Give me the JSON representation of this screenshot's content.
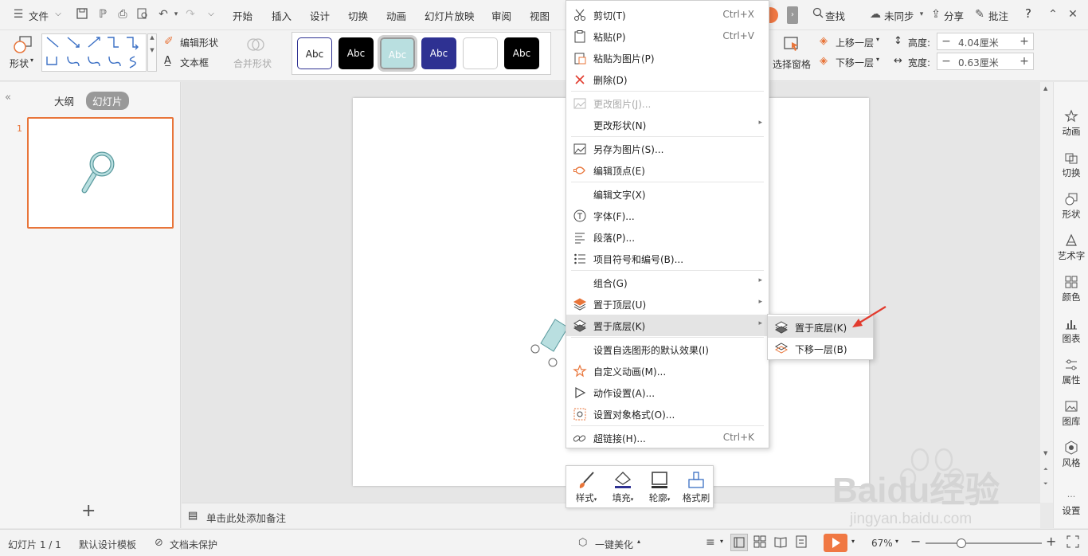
{
  "menubar": {
    "file": "文件",
    "tabs": [
      "开始",
      "插入",
      "设计",
      "切换",
      "动画",
      "幻灯片放映",
      "审阅",
      "视图"
    ],
    "search": "查找",
    "sync": "未同步",
    "share": "分享",
    "comment": "批注",
    "help": "?"
  },
  "ribbon": {
    "shape": "形状",
    "edit_shape": "编辑形状",
    "textbox": "文本框",
    "merge_shape": "合并形状",
    "style_boxes": [
      "Abc",
      "Abc",
      "Abc",
      "Abc",
      "",
      "Abc"
    ],
    "select_pane": "选择窗格",
    "bring_forward": "上移一层",
    "send_backward": "下移一层",
    "height_label": "高度:",
    "height_value": "4.04厘米",
    "width_label": "宽度:",
    "width_value": "0.63厘米",
    "minus": "−",
    "plus": "+"
  },
  "left_panel": {
    "tab_outline": "大纲",
    "tab_slides": "幻灯片",
    "slide_number": "1",
    "collapse": "«",
    "add": "+"
  },
  "notes": {
    "placeholder": "单击此处添加备注"
  },
  "right_sidebar": {
    "items": [
      "动画",
      "切换",
      "形状",
      "艺术字",
      "颜色",
      "图表",
      "属性",
      "图库",
      "风格",
      "设置"
    ],
    "more": "···"
  },
  "status": {
    "slide_info": "幻灯片 1 / 1",
    "template": "默认设计模板",
    "protect": "文档未保护",
    "beautify": "一键美化",
    "zoom": "67%"
  },
  "context_menu": {
    "items": [
      {
        "label": "剪切(T)",
        "shortcut": "Ctrl+X"
      },
      {
        "label": "粘贴(P)",
        "shortcut": "Ctrl+V"
      },
      {
        "label": "粘贴为图片(P)",
        "shortcut": ""
      },
      {
        "label": "删除(D)",
        "shortcut": ""
      },
      {
        "label": "更改图片(J)...",
        "shortcut": ""
      },
      {
        "label": "更改形状(N)",
        "shortcut": ""
      },
      {
        "label": "另存为图片(S)...",
        "shortcut": ""
      },
      {
        "label": "编辑顶点(E)",
        "shortcut": ""
      },
      {
        "label": "编辑文字(X)",
        "shortcut": ""
      },
      {
        "label": "字体(F)...",
        "shortcut": ""
      },
      {
        "label": "段落(P)...",
        "shortcut": ""
      },
      {
        "label": "项目符号和编号(B)...",
        "shortcut": ""
      },
      {
        "label": "组合(G)",
        "shortcut": ""
      },
      {
        "label": "置于顶层(U)",
        "shortcut": ""
      },
      {
        "label": "置于底层(K)",
        "shortcut": ""
      },
      {
        "label": "设置自选图形的默认效果(I)",
        "shortcut": ""
      },
      {
        "label": "自定义动画(M)...",
        "shortcut": ""
      },
      {
        "label": "动作设置(A)...",
        "shortcut": ""
      },
      {
        "label": "设置对象格式(O)...",
        "shortcut": ""
      },
      {
        "label": "超链接(H)...",
        "shortcut": "Ctrl+K"
      }
    ]
  },
  "submenu": {
    "items": [
      "置于底层(K)",
      "下移一层(B)"
    ]
  },
  "mini_toolbar": {
    "items": [
      "样式",
      "填充",
      "轮廓",
      "格式刷"
    ]
  },
  "colors": {
    "accent_orange": "#e8753a",
    "shape_fill": "#b9dfe0",
    "shape_stroke": "#5a9a9e",
    "arrow_red": "#e23b2e",
    "style_navy": "#2e3192"
  },
  "watermark": {
    "brand": "Baidu经验",
    "url": "jingyan.baidu.com"
  }
}
